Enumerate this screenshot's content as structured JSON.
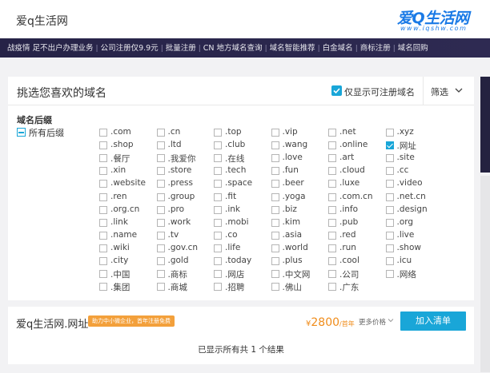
{
  "search": {
    "text": "爱q生活网"
  },
  "logo": {
    "main": "爱Q生活网",
    "sub": "www.iqshw.com"
  },
  "nav": {
    "items": [
      "战疫情 足不出户办理业务",
      "公司注册仅9.9元",
      "批量注册",
      "CN 地方域名查询",
      "域名智能推荐",
      "白金域名",
      "商标注册",
      "域名回购"
    ]
  },
  "panel": {
    "title": "挑选您喜欢的域名",
    "only_registrable": "仅显示可注册域名",
    "filter": "筛选"
  },
  "suffix": {
    "title": "域名后缀",
    "all_label": "所有后缀",
    "rows": [
      [
        ".com",
        ".cn",
        ".top",
        ".vip",
        ".net",
        ".xyz"
      ],
      [
        ".shop",
        ".ltd",
        ".club",
        ".wang",
        ".online",
        ".网址"
      ],
      [
        ".餐厅",
        ".我爱你",
        ".在线",
        ".love",
        ".art",
        ".site"
      ],
      [
        ".xin",
        ".store",
        ".tech",
        ".fun",
        ".cloud",
        ".cc"
      ],
      [
        ".website",
        ".press",
        ".space",
        ".beer",
        ".luxe",
        ".video"
      ],
      [
        ".ren",
        ".group",
        ".fit",
        ".yoga",
        ".com.cn",
        ".net.cn"
      ],
      [
        ".org.cn",
        ".pro",
        ".ink",
        ".biz",
        ".info",
        ".design"
      ],
      [
        ".link",
        ".work",
        ".mobi",
        ".kim",
        ".pub",
        ".org"
      ],
      [
        ".name",
        ".tv",
        ".co",
        ".asia",
        ".red",
        ".live"
      ],
      [
        ".wiki",
        ".gov.cn",
        ".life",
        ".world",
        ".run",
        ".show"
      ],
      [
        ".city",
        ".gold",
        ".today",
        ".plus",
        ".cool",
        ".icu"
      ],
      [
        ".中国",
        ".商标",
        ".网店",
        ".中文网",
        ".公司",
        ".网络"
      ],
      [
        ".集团",
        ".商城",
        ".招聘",
        ".佛山",
        ".广东",
        ""
      ]
    ],
    "checked": ".网址"
  },
  "result": {
    "domain": "爱q生活网.网址",
    "promo": "助力中小微企业，首年注册免费",
    "price_symbol": "¥",
    "price": "2800",
    "price_unit": "/首年",
    "more_price": "更多价格",
    "add_button": "加入清单"
  },
  "footer": {
    "text": "已显示所有共 1 个结果"
  },
  "colors": {
    "accent": "#19a6d8",
    "nav_bg": "#262347",
    "price": "#f08c1a",
    "promo": "#f3a03b"
  }
}
